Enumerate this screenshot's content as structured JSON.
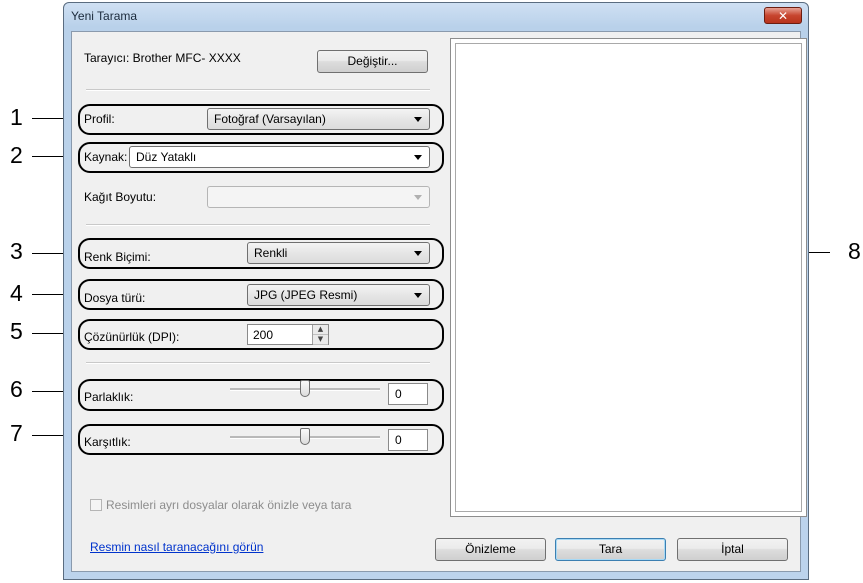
{
  "window": {
    "title": "Yeni Tarama",
    "close_symbol": "✕"
  },
  "scanner": {
    "label": "Tarayıcı: Brother MFC- XXXX",
    "change_button": "Değiştir..."
  },
  "profile": {
    "label": "Profil:",
    "value": "Fotoğraf (Varsayılan)"
  },
  "source": {
    "label": "Kaynak:",
    "value": "Düz Yataklı"
  },
  "paper_size": {
    "label": "Kağıt Boyutu:",
    "value": ""
  },
  "color_format": {
    "label": "Renk Biçimi:",
    "value": "Renkli"
  },
  "file_type": {
    "label": "Dosya türü:",
    "value": "JPG (JPEG Resmi)"
  },
  "resolution": {
    "label": "Çözünürlük (DPI):",
    "value": "200"
  },
  "brightness": {
    "label": "Parlaklık:",
    "value": "0",
    "slider_level": 0.5
  },
  "contrast": {
    "label": "Karşıtlık:",
    "value": "0",
    "slider_level": 0.5
  },
  "separate_files": {
    "label": "Resimleri ayrı dosyalar olarak önizle veya tara",
    "checked": false
  },
  "help_link": "Resmin nasıl taranacağını görün",
  "buttons": {
    "preview": "Önizleme",
    "scan": "Tara",
    "cancel": "İptal"
  },
  "callouts": [
    "1",
    "2",
    "3",
    "4",
    "5",
    "6",
    "7",
    "8"
  ]
}
